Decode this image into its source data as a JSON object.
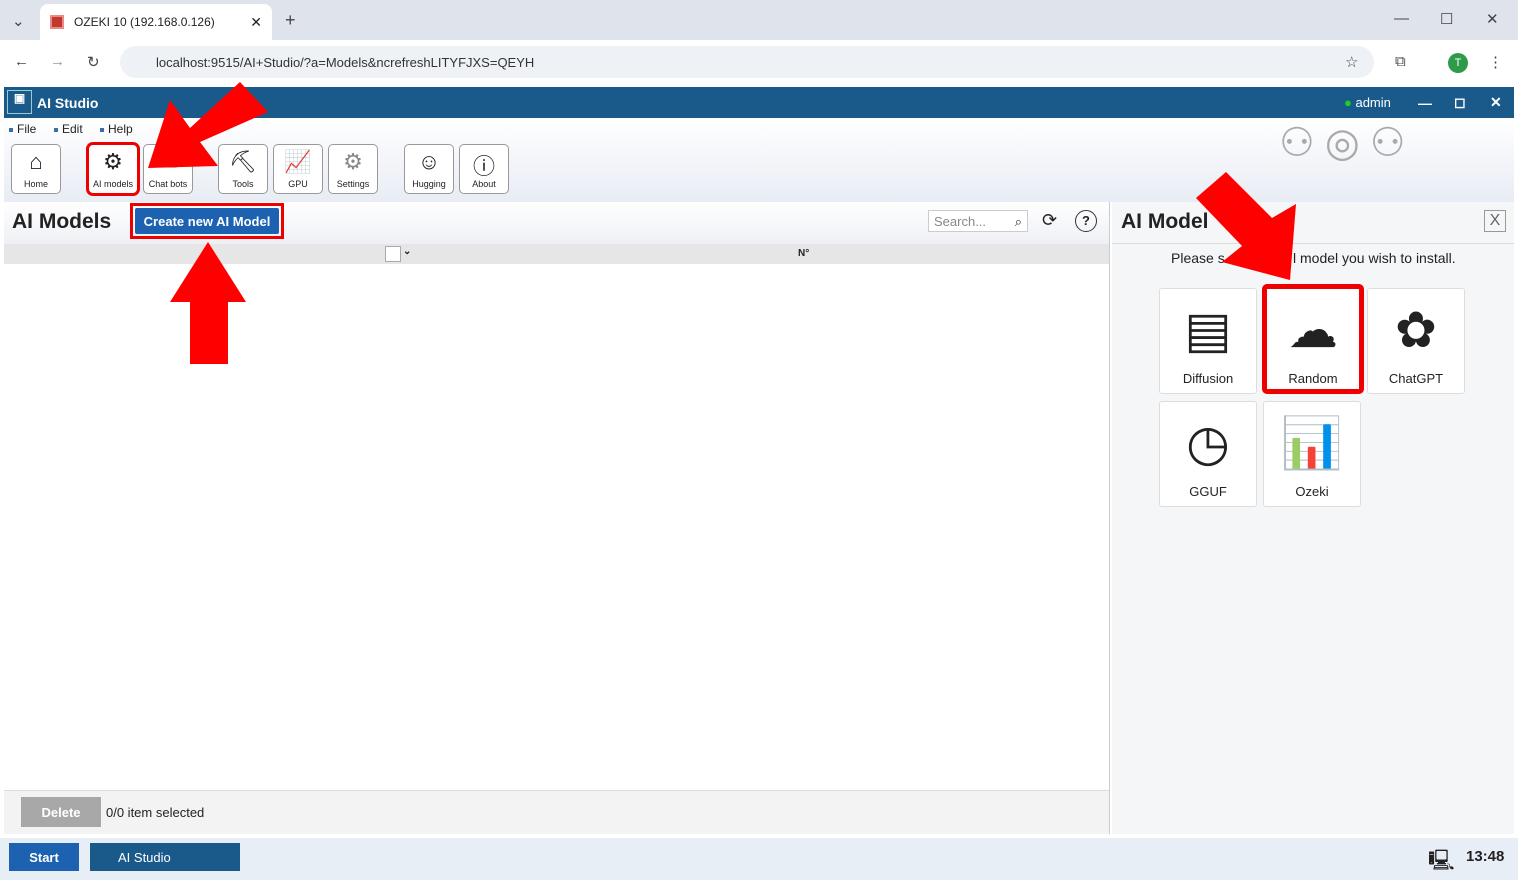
{
  "browser": {
    "tab_title": "OZEKI 10 (192.168.0.126)",
    "url": "localhost:9515/AI+Studio/?a=Models&ncrefreshLITYFJXS=QEYH",
    "profile": "T"
  },
  "app": {
    "title": "AI Studio",
    "user": "admin"
  },
  "menu": [
    "File",
    "Edit",
    "Help"
  ],
  "toolbar": [
    {
      "label": "Home",
      "icon": "home-icon"
    },
    {
      "label": "AI models",
      "icon": "ai-models-icon"
    },
    {
      "label": "Chat bots",
      "icon": "chat-bots-icon"
    },
    {
      "label": "Tools",
      "icon": "tools-icon"
    },
    {
      "label": "GPU",
      "icon": "gpu-icon"
    },
    {
      "label": "Settings",
      "icon": "gear-icon"
    },
    {
      "label": "Hugging",
      "icon": "hugging-face-icon"
    },
    {
      "label": "About",
      "icon": "info-icon"
    }
  ],
  "left": {
    "title": "AI Models",
    "create_label": "Create new AI Model",
    "search_placeholder": "Search...",
    "col_no": "N°",
    "delete_label": "Delete",
    "selection_status": "0/0 item selected"
  },
  "right": {
    "title": "AI Model",
    "instruction_start": "Please s",
    "instruction_end": "l model you wish to install.",
    "models": [
      "Diffusion",
      "Random",
      "ChatGPT",
      "GGUF",
      "Ozeki"
    ]
  },
  "taskbar": {
    "start": "Start",
    "app": "AI Studio",
    "time": "13:48"
  },
  "colors": {
    "header": "#1a5a8a",
    "accent": "#1d62b0",
    "highlight": "#e00000"
  }
}
